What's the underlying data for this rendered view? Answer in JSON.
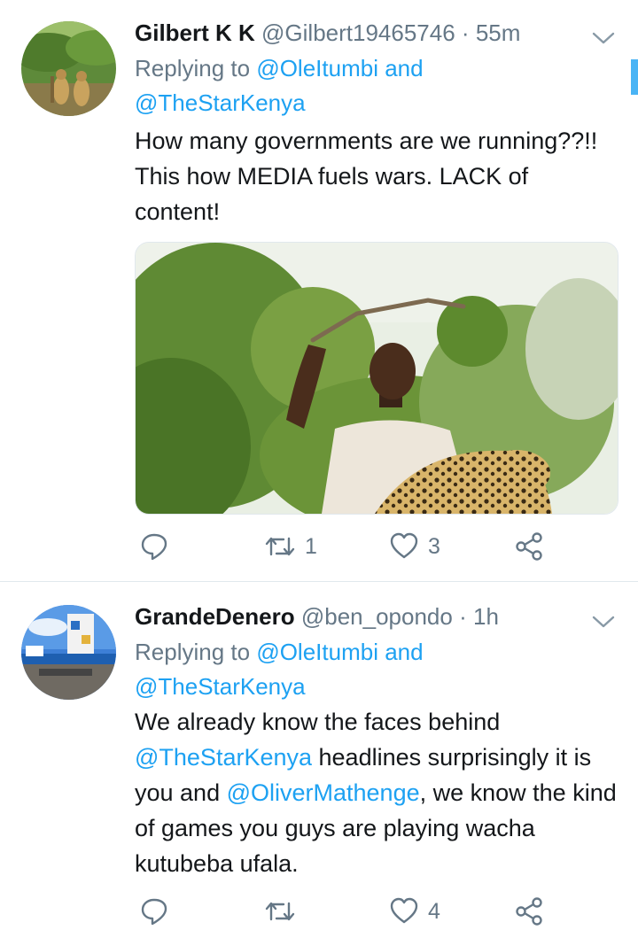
{
  "tweets": [
    {
      "display_name": "Gilbert K K",
      "handle": "@Gilbert19465746",
      "separator": "·",
      "time": "55m",
      "replying_prefix": "Replying to",
      "reply_mention_1": "@OleItumbi",
      "reply_and": "and",
      "reply_mention_2": "@TheStarKenya",
      "text": "How many governments are we running??!! This how MEDIA fuels wars. LACK of content!",
      "retweets": "1",
      "likes": "3"
    },
    {
      "display_name": "GrandeDenero",
      "handle": "@ben_opondo",
      "separator": "·",
      "time": "1h",
      "replying_prefix": "Replying to",
      "reply_mention_1": "@OleItumbi",
      "reply_and": "and",
      "reply_mention_2": "@TheStarKenya",
      "text_part_1": "We  already know the faces behind",
      "text_mention_1": "@TheStarKenya",
      "text_part_2": " headlines surprisingly it is you and ",
      "text_mention_2": "@OliverMathenge",
      "text_part_3": ", we know the kind of games you guys are playing wacha kutubeba ufala.",
      "likes": "4"
    }
  ],
  "icons": {
    "reply": "reply-icon",
    "retweet": "retweet-icon",
    "like": "heart-icon",
    "share": "share-icon",
    "menu": "chevron-down-icon"
  },
  "colors": {
    "link": "#1da1f2",
    "secondary_text": "#657786",
    "primary_text": "#14171a",
    "divider": "#e1e8ed"
  }
}
